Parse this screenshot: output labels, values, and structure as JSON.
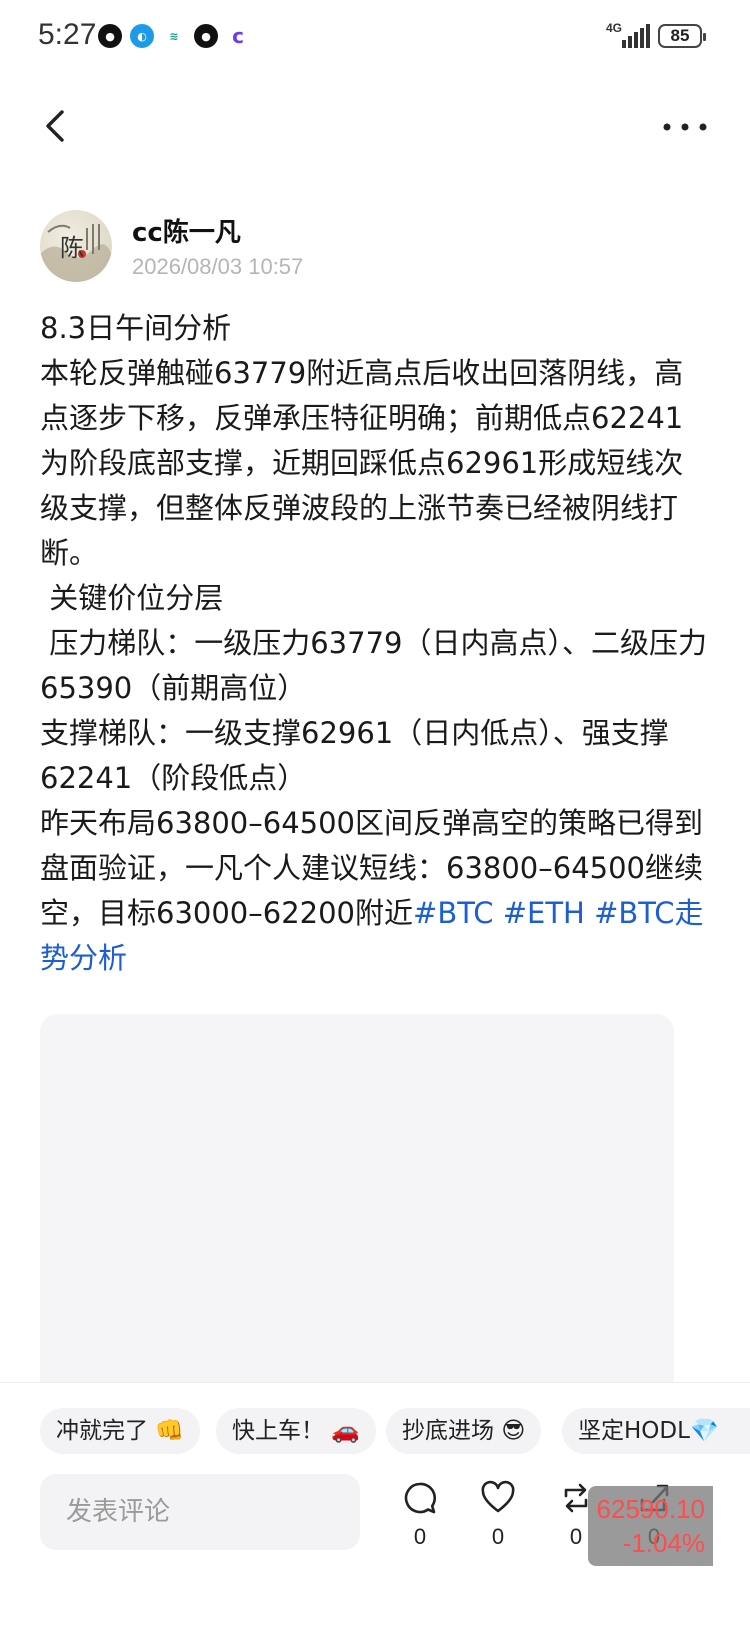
{
  "status_bar": {
    "time": "5:27",
    "network": "4G",
    "battery": "85"
  },
  "author": {
    "name": "cc陈一凡",
    "datetime": "2026/08/03 10:57",
    "avatar_char": "陈"
  },
  "post": {
    "paragraphs": [
      "8.3日午间分析",
      "本轮反弹触碰63779附近高点后收出回落阴线，高点逐步下移，反弹承压特征明确；前期低点62241为阶段底部支撑，近期回踩低点62961形成短线次级支撑，但整体反弹波段的上涨节奏已经被阴线打断。",
      " 关键价位分层",
      " 压力梯队：一级压力63779（日内高点）、二级压力65390（前期高位）",
      "支撑梯队：一级支撑62961（日内低点）、强支撑62241（阶段低点）"
    ],
    "last_paragraph_text": "昨天布局63800–64500区间反弹高空的策略已得到盘面验证，一凡个人建议短线：63800–64500继续空，目标63000–62200附近",
    "tags": [
      "#BTC",
      "#ETH",
      "#BTC走势分析"
    ]
  },
  "quick_replies": [
    {
      "label": "冲就完了",
      "emoji": "👊"
    },
    {
      "label": "快上车！",
      "emoji": "🚗"
    },
    {
      "label": "抄底进场",
      "emoji": "😎"
    },
    {
      "label": "坚定HODL",
      "emoji": "💎"
    }
  ],
  "comment_input": {
    "placeholder": "发表评论"
  },
  "actions": {
    "comments": "0",
    "likes": "0",
    "reposts": "0",
    "shares": "0"
  },
  "ticker": {
    "price": "62590.10",
    "change": "-1.04%",
    "color": "#ff4d4f"
  }
}
